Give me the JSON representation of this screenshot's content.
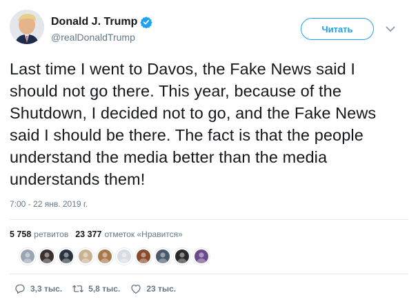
{
  "user": {
    "display_name": "Donald J. Trump",
    "handle": "@realDonaldTrump",
    "verified": true
  },
  "follow_label": "Читать",
  "tweet": {
    "text": "Last time I went to Davos, the Fake News said I should not go there. This year, because of the Shutdown, I decided not to go, and the Fake News said I should be there. The fact is that the people understand the media better than the media understands them!",
    "timestamp": "7:00 - 22 янв. 2019 г."
  },
  "stats": {
    "retweets_count": "5 758",
    "retweets_label": "ретвитов",
    "likes_count": "23 377",
    "likes_label": "отметок «Нравится»"
  },
  "likers": [
    {
      "icon": "user-avatar",
      "color": "#9aa5b1"
    },
    {
      "icon": "user-avatar",
      "color": "#3b2f2f"
    },
    {
      "icon": "user-avatar",
      "color": "#2b3340"
    },
    {
      "icon": "user-avatar",
      "color": "#c9b28f"
    },
    {
      "icon": "user-avatar",
      "color": "#a8784a"
    },
    {
      "icon": "user-avatar",
      "color": "#d7dde3"
    },
    {
      "icon": "user-avatar",
      "color": "#8a4a2a"
    },
    {
      "icon": "user-avatar",
      "color": "#4a5a6a"
    },
    {
      "icon": "user-avatar",
      "color": "#2a2a2a"
    },
    {
      "icon": "user-avatar",
      "color": "#6a4a8a"
    }
  ],
  "actions": {
    "replies": "3,3 тыс.",
    "retweets": "5,8 тыс.",
    "likes": "23 тыс."
  },
  "colors": {
    "accent": "#1da1f2",
    "text": "#14171a",
    "secondary": "#657786",
    "divider": "#e6ecf0"
  }
}
